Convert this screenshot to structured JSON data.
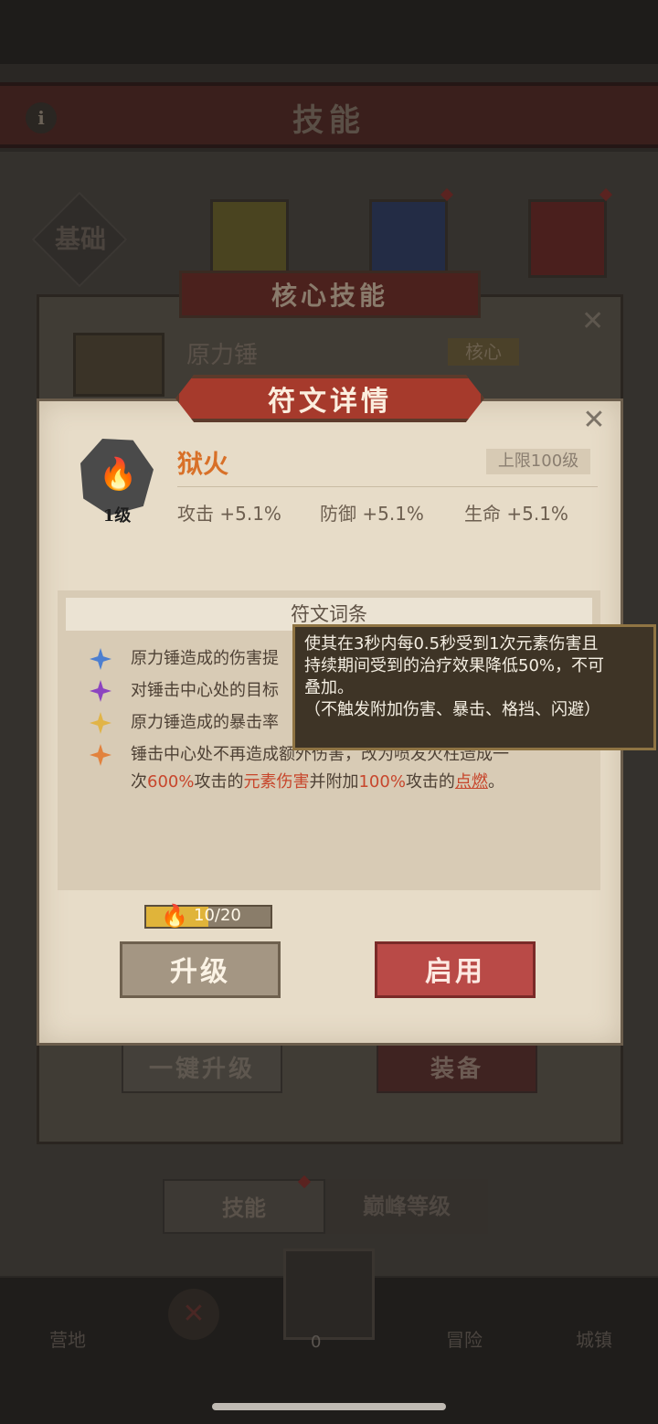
{
  "background": {
    "header_title": "技能",
    "info_icon": "i",
    "tab_basic": "基础",
    "core_panel": {
      "title": "核心技能",
      "skill_name": "原力锤",
      "skill_tag": "核心"
    },
    "buttons": {
      "upgrade_all": "一键升级",
      "equip": "装备"
    },
    "subtabs": [
      "技能",
      "巅峰等级"
    ],
    "nav": {
      "camp": "营地",
      "adventure": "冒险",
      "town": "城镇",
      "gem_count": "0"
    }
  },
  "rune_dialog": {
    "title": "符文详情",
    "rune_name": "狱火",
    "level_badge": "1级",
    "level_cap": "上限100级",
    "stats": [
      "攻击 +5.1%",
      "防御 +5.1%",
      "生命 +5.1%"
    ],
    "entries_title": "符文词条",
    "entries": [
      {
        "color": "#4d7fd0",
        "text": "原力锤造成的伤害提"
      },
      {
        "color": "#8c44c0",
        "text": "对锤击中心处的目标"
      },
      {
        "color": "#e1b447",
        "text": "原力锤造成的暴击率"
      },
      {
        "color": "#e2823d",
        "line1": "锤击中心处不再造成额外伤害，改为喷发火柱造成一",
        "line2_a": "次",
        "line2_b": "600%",
        "line2_c": "攻击的",
        "line2_d": "元素伤害",
        "line2_e": "并附加",
        "line2_f": "100%",
        "line2_g": "攻击的",
        "line2_h": "点燃",
        "line2_i": "。"
      }
    ],
    "tooltip": [
      "使其在3秒内每0.5秒受到1次元素伤害且",
      "持续期间受到的治疗效果降低50%，不可",
      "叠加。",
      "（不触发附加伤害、暴击、格挡、闪避）"
    ],
    "progress": {
      "text": "10/20",
      "fraction": 0.5
    },
    "buttons": {
      "upgrade": "升级",
      "enable": "启用"
    }
  }
}
